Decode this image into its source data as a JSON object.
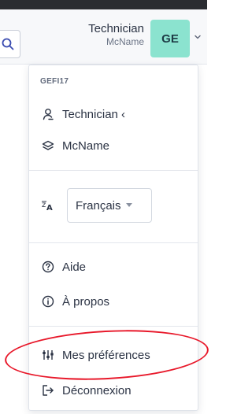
{
  "header": {
    "user_name": "Technician",
    "user_entity": "McName",
    "avatar_initials": "GE"
  },
  "menu": {
    "entity_code": "GEFI17",
    "profile_label": "Technician ‹",
    "entity_label": "McName",
    "language_value": "Français",
    "help_label": "Aide",
    "about_label": "À propos",
    "preferences_label": "Mes préférences",
    "logout_label": "Déconnexion"
  },
  "colors": {
    "avatar_bg": "#8be3cf",
    "annotation_ring": "#e8182a",
    "top_bar": "#2a2c31"
  },
  "icons": [
    "search-icon",
    "chevron-down-icon",
    "user-icon",
    "layers-icon",
    "translate-icon",
    "help-circle-icon",
    "info-circle-icon",
    "sliders-icon",
    "logout-icon"
  ]
}
